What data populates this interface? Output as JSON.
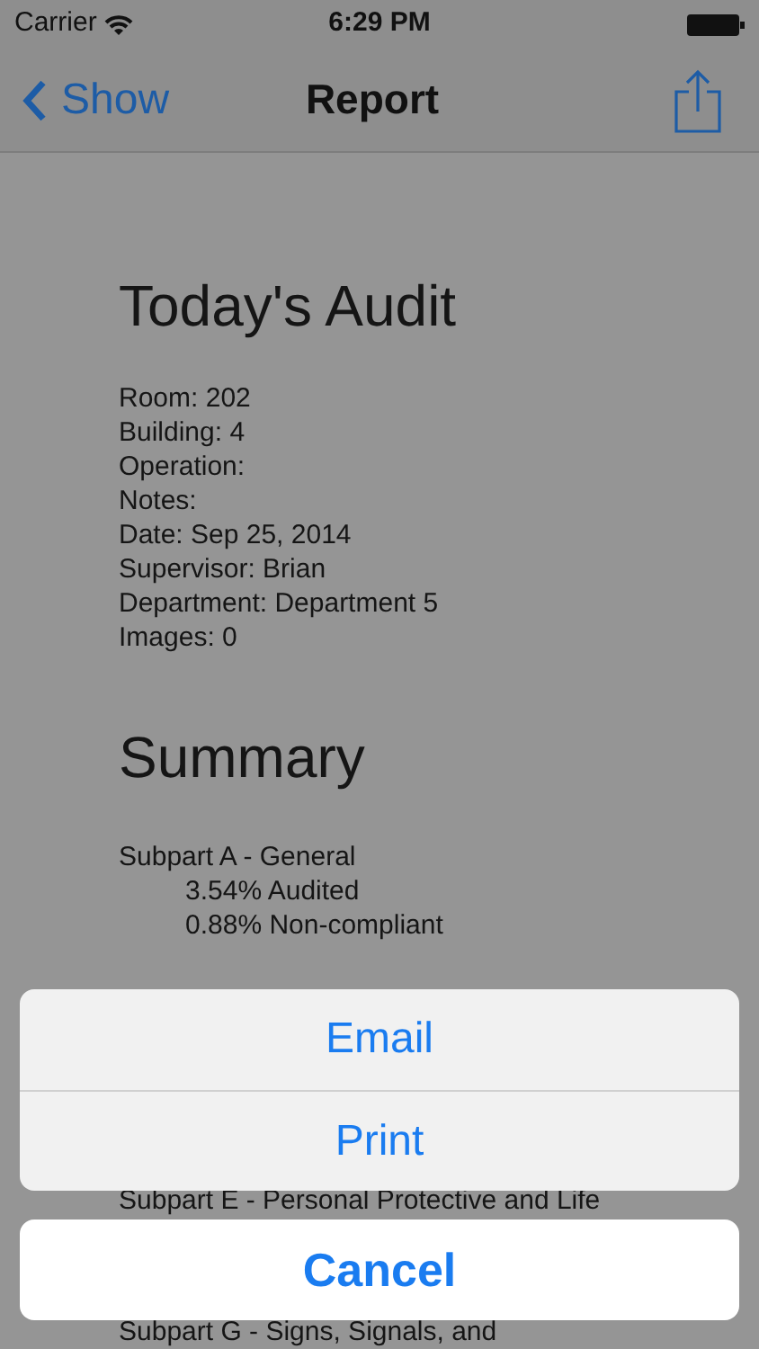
{
  "status_bar": {
    "carrier": "Carrier",
    "time": "6:29 PM"
  },
  "nav_bar": {
    "back_label": "Show",
    "title": "Report"
  },
  "document": {
    "heading": "Today's Audit",
    "fields": [
      "Room: 202",
      "Building: 4",
      "Operation:",
      "Notes:",
      "Date: Sep 25, 2014",
      "Supervisor: Brian",
      "Department: Department 5",
      "Images: 0"
    ],
    "summary_heading": "Summary",
    "sections": [
      {
        "title": "Subpart A - General",
        "items": [
          "3.54% Audited",
          "0.88% Non-compliant"
        ]
      },
      {
        "title": "Subpart E - Personal Protective and Life"
      },
      {
        "title": "Subpart G - Signs, Signals, and"
      }
    ]
  },
  "action_sheet": {
    "actions": [
      "Email",
      "Print"
    ],
    "cancel": "Cancel"
  }
}
